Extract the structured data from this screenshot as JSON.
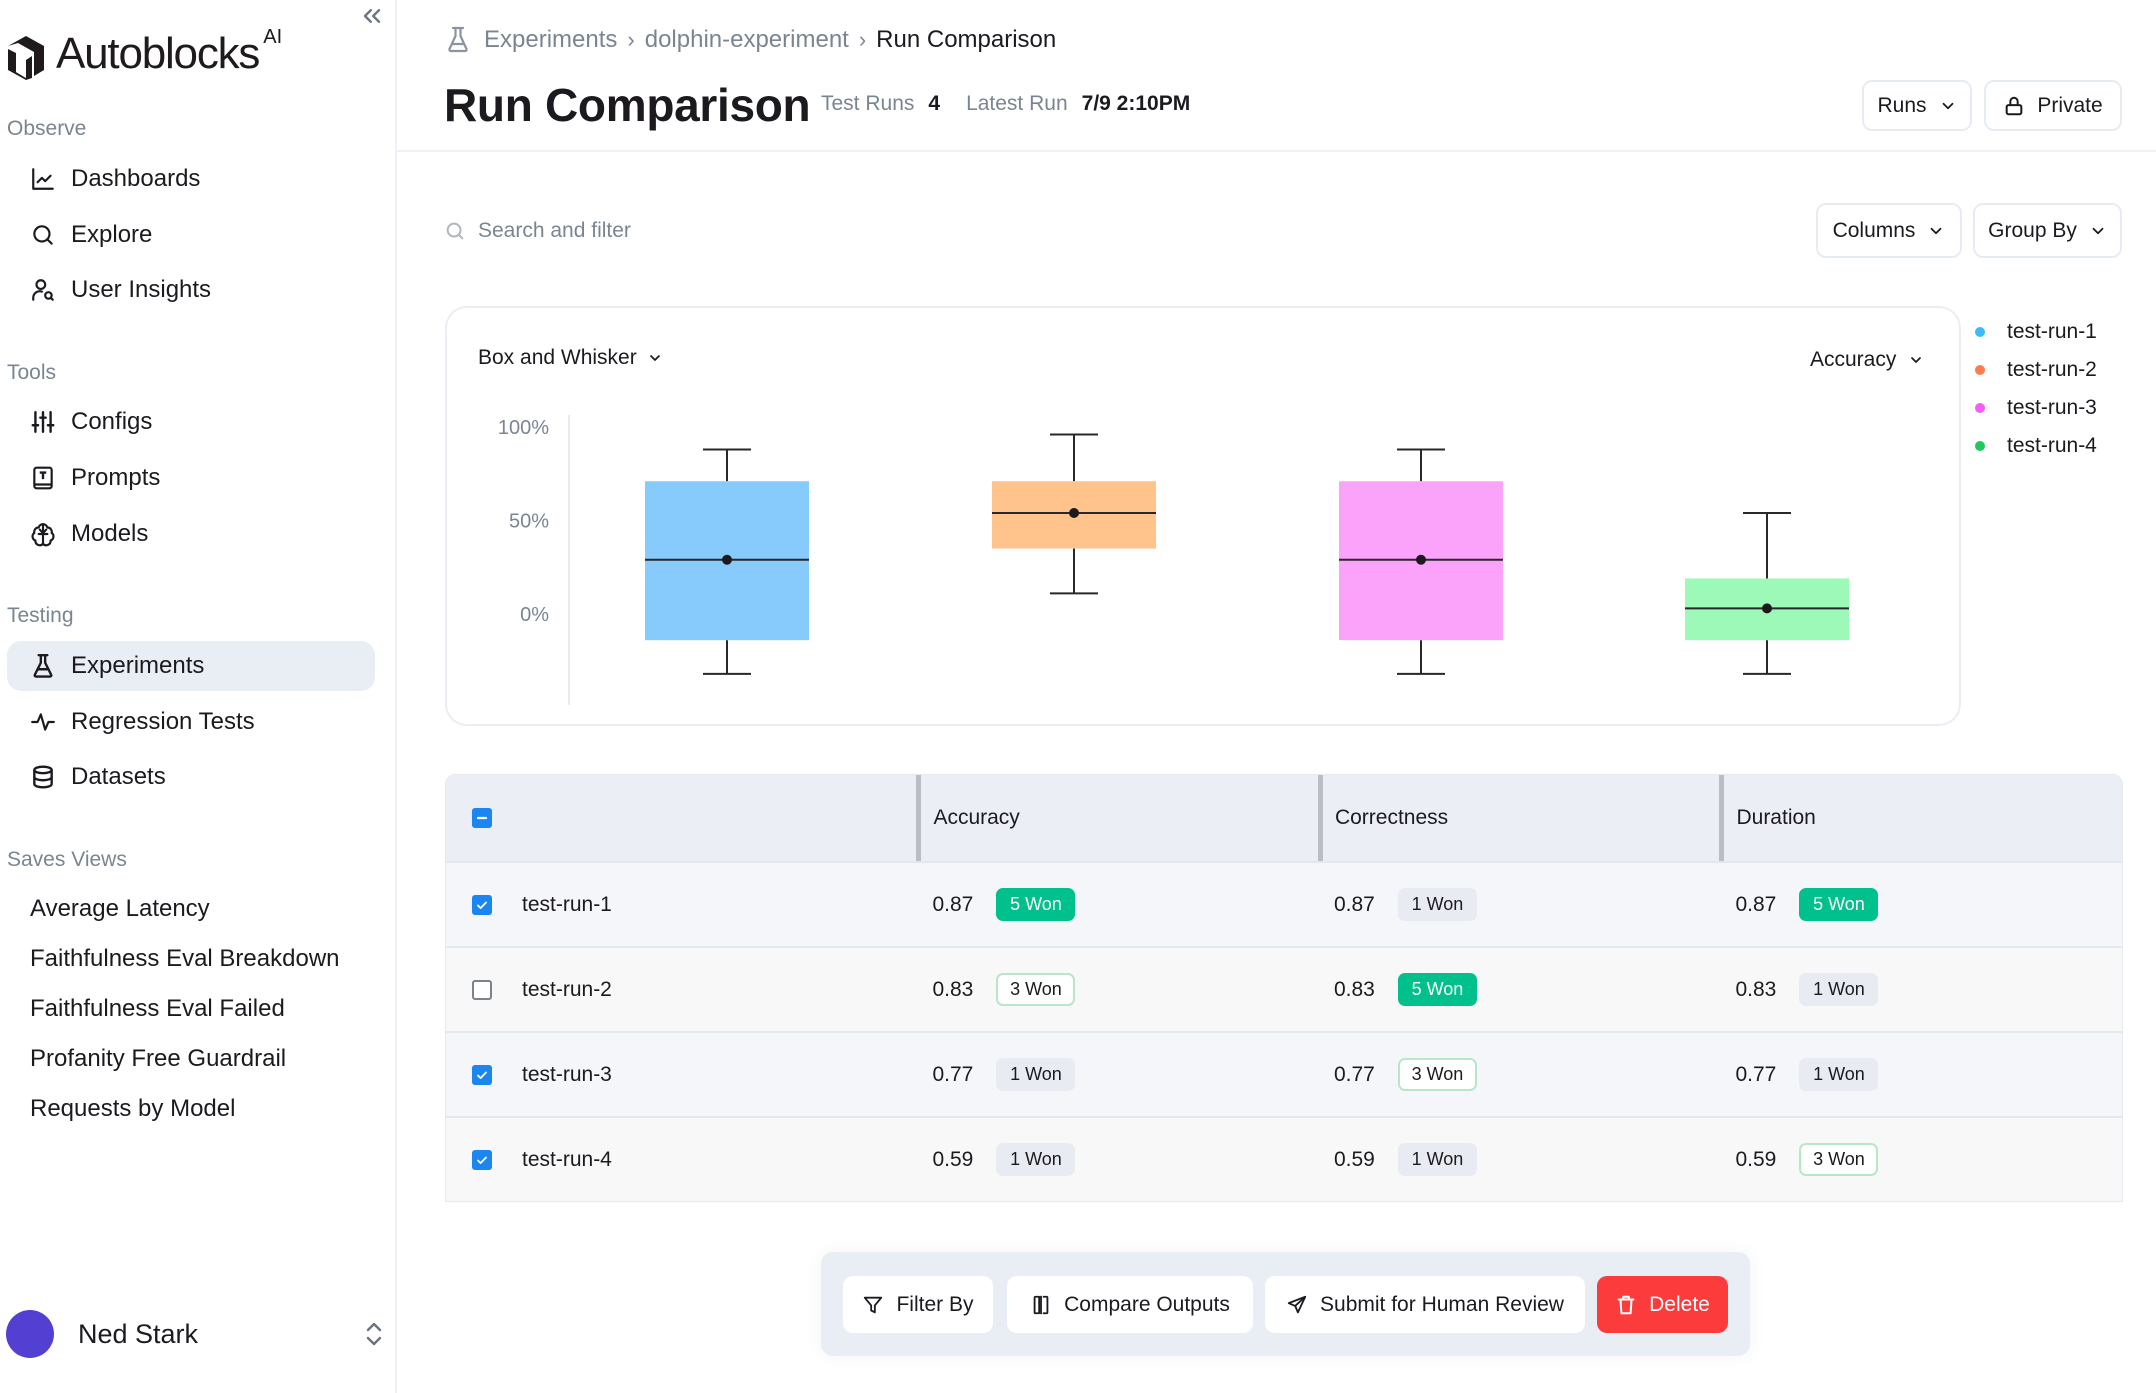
{
  "sidebar": {
    "logo_text": "Autoblocks",
    "logo_suffix": "AI",
    "sections": [
      {
        "label": "Observe",
        "items": [
          {
            "label": "Dashboards",
            "icon": "chart-line-icon"
          },
          {
            "label": "Explore",
            "icon": "search-icon"
          },
          {
            "label": "User Insights",
            "icon": "user-search-icon"
          }
        ]
      },
      {
        "label": "Tools",
        "items": [
          {
            "label": "Configs",
            "icon": "sliders-icon"
          },
          {
            "label": "Prompts",
            "icon": "prompt-book-icon"
          },
          {
            "label": "Models",
            "icon": "brain-icon"
          }
        ]
      },
      {
        "label": "Testing",
        "items": [
          {
            "label": "Experiments",
            "icon": "flask-icon",
            "active": true
          },
          {
            "label": "Regression Tests",
            "icon": "pulse-icon"
          },
          {
            "label": "Datasets",
            "icon": "database-icon"
          }
        ]
      }
    ],
    "saved_views_label": "Saves Views",
    "saved_views": [
      "Average Latency",
      "Faithfulness Eval Breakdown",
      "Faithfulness Eval Failed",
      "Profanity Free Guardrail",
      "Requests by Model"
    ],
    "user": {
      "name": "Ned Stark",
      "avatar_color": "#5340d3"
    }
  },
  "header": {
    "breadcrumb": [
      "Experiments",
      "dolphin-experiment",
      "Run Comparison"
    ],
    "title": "Run Comparison",
    "meta": [
      {
        "label": "Test Runs",
        "value": "4"
      },
      {
        "label": "Latest Run",
        "value": "7/9 2:10PM"
      }
    ],
    "runs_button": "Runs",
    "private_button": "Private"
  },
  "toolbar": {
    "search_placeholder": "Search and filter",
    "columns_button": "Columns",
    "group_by_button": "Group By"
  },
  "chart_controls": {
    "chart_type": "Box and Whisker",
    "metric": "Accuracy"
  },
  "chart_data": {
    "type": "box",
    "title": "",
    "xlabel": "",
    "ylabel": "Accuracy",
    "y_ticks": [
      "100%",
      "50%",
      "0%"
    ],
    "y_tick_values": [
      100,
      50,
      0
    ],
    "ylim": [
      -40,
      100
    ],
    "grid": false,
    "legend_position": "right",
    "series": [
      {
        "name": "test-run-1",
        "color": "#38bdf8",
        "fill": "#87cbfd",
        "min": -32,
        "q1": -14,
        "median": 29,
        "q3": 71,
        "max": 88
      },
      {
        "name": "test-run-2",
        "color": "#fb7c4c",
        "fill": "#ffc38b",
        "min": 11,
        "q1": 35,
        "median": 54,
        "q3": 71,
        "max": 96
      },
      {
        "name": "test-run-3",
        "color": "#f65cf8",
        "fill": "#fba3fb",
        "min": -32,
        "q1": -14,
        "median": 29,
        "q3": 71,
        "max": 88
      },
      {
        "name": "test-run-4",
        "color": "#1fc95a",
        "fill": "#9cf9b7",
        "min": -32,
        "q1": -14,
        "median": 3,
        "q3": 19,
        "max": 54
      }
    ]
  },
  "table": {
    "columns": [
      "Accuracy",
      "Correctness",
      "Duration"
    ],
    "header_checkbox": "indeterminate",
    "rows": [
      {
        "name": "test-run-1",
        "checked": true,
        "cells": [
          {
            "value": "0.87",
            "badge": "5 Won",
            "tier": "gold"
          },
          {
            "value": "0.87",
            "badge": "1 Won",
            "tier": "bronze"
          },
          {
            "value": "0.87",
            "badge": "5 Won",
            "tier": "gold"
          }
        ]
      },
      {
        "name": "test-run-2",
        "checked": false,
        "cells": [
          {
            "value": "0.83",
            "badge": "3 Won",
            "tier": "silver"
          },
          {
            "value": "0.83",
            "badge": "5 Won",
            "tier": "gold"
          },
          {
            "value": "0.83",
            "badge": "1 Won",
            "tier": "bronze"
          }
        ]
      },
      {
        "name": "test-run-3",
        "checked": true,
        "cells": [
          {
            "value": "0.77",
            "badge": "1 Won",
            "tier": "bronze"
          },
          {
            "value": "0.77",
            "badge": "3 Won",
            "tier": "silver"
          },
          {
            "value": "0.77",
            "badge": "1 Won",
            "tier": "bronze"
          }
        ]
      },
      {
        "name": "test-run-4",
        "checked": true,
        "cells": [
          {
            "value": "0.59",
            "badge": "1 Won",
            "tier": "bronze"
          },
          {
            "value": "0.59",
            "badge": "1 Won",
            "tier": "bronze"
          },
          {
            "value": "0.59",
            "badge": "3 Won",
            "tier": "silver"
          }
        ]
      }
    ]
  },
  "actions": {
    "filter_by": "Filter By",
    "compare_outputs": "Compare Outputs",
    "submit_review": "Submit for Human Review",
    "delete": "Delete",
    "delete_color": "#fc3c3c"
  }
}
